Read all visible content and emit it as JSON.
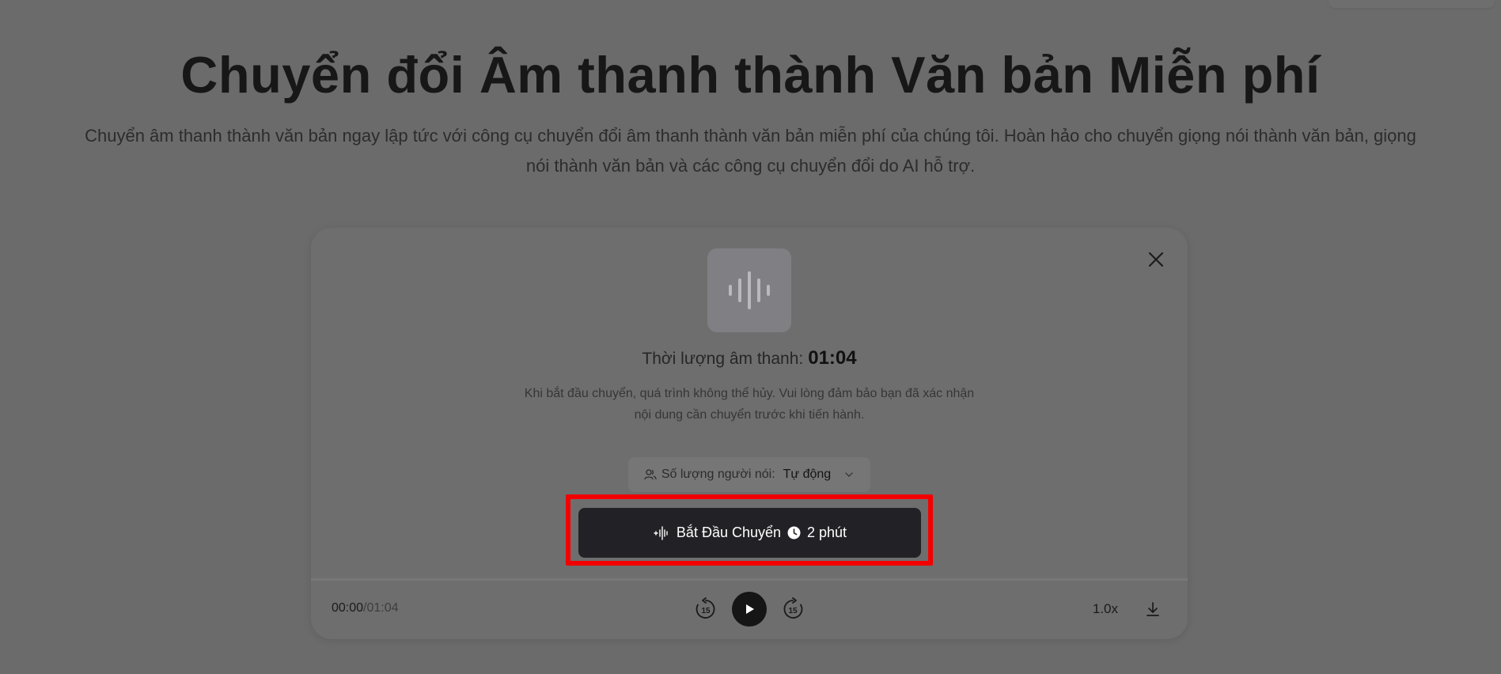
{
  "hero": {
    "title": "Chuyển đổi Âm thanh thành Văn bản Miễn phí",
    "subtitle_line1": "Chuyển âm thanh thành văn bản ngay lập tức với công cụ chuyển đổi âm thanh thành văn bản miễn phí của chúng tôi. Hoàn hảo cho chuyển giọng nói thành văn bản, giọng",
    "subtitle_line2": "nói thành văn bản và các công cụ chuyển đổi do AI hỗ trợ."
  },
  "card": {
    "duration_label": "Thời lượng âm thanh:",
    "duration_value": "01:04",
    "notice_line1": "Khi bắt đầu chuyển, quá trình không thể hủy. Vui lòng đảm bảo bạn đã xác nhận",
    "notice_line2": "nội dung cần chuyển trước khi tiến hành.",
    "speaker_label": "Số lượng người nói:",
    "speaker_value": "Tự động",
    "start_label": "Bắt Đầu Chuyển",
    "start_eta": "2 phút"
  },
  "player": {
    "current_time": "00:00",
    "total_time": "/01:04",
    "skip_back_seconds": "15",
    "skip_forward_seconds": "15",
    "speed": "1.0x"
  },
  "icons": {
    "close": "close-icon",
    "waveform": "waveform-icon",
    "speakers": "users-icon",
    "chevron": "chevron-down-icon",
    "sparkle_wave": "sparkle-waveform-icon",
    "clock": "clock-icon",
    "play": "play-icon",
    "rewind": "rewind-15-icon",
    "forward": "forward-15-icon",
    "download": "download-icon"
  },
  "colors": {
    "overlay_bg": "#6b6b6b",
    "button_bg": "#222226",
    "highlight": "#f20000"
  }
}
